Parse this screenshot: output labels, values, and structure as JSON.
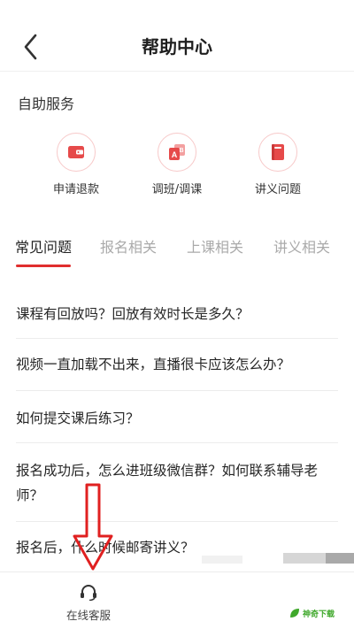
{
  "header": {
    "title": "帮助中心"
  },
  "self_service": {
    "title": "自助服务",
    "items": [
      {
        "label": "申请退款",
        "icon": "wallet-icon"
      },
      {
        "label": "调班/调课",
        "icon": "switch-class-icon"
      },
      {
        "label": "讲义问题",
        "icon": "book-icon"
      }
    ]
  },
  "tabs": [
    "常见问题",
    "报名相关",
    "上课相关",
    "讲义相关"
  ],
  "faqs": [
    "课程有回放吗？回放有效时长是多久？",
    "视频一直加载不出来，直播很卡应该怎么办？",
    "如何提交课后练习？",
    "报名成功后，怎么进班级微信群？如何联系辅导老师？",
    "报名后，什么时候邮寄讲义？"
  ],
  "bottom_bar": {
    "customer_service_label": "在线客服",
    "icon": "headset-icon"
  },
  "watermark": {
    "text": "神奇下载"
  },
  "colors": {
    "accent": "#e02e2e",
    "annotation_arrow": "#e02020",
    "watermark": "#3fa82b"
  }
}
